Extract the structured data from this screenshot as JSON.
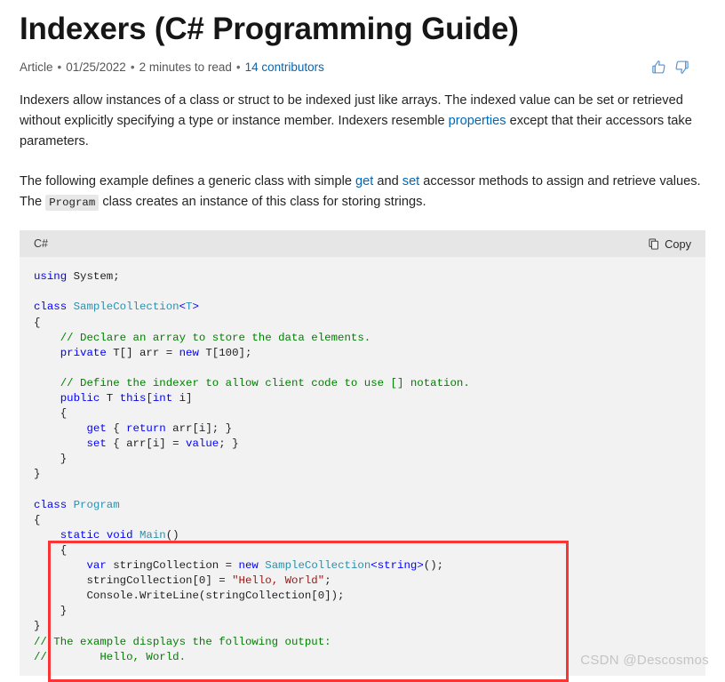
{
  "article": {
    "title": "Indexers (C# Programming Guide)",
    "meta": {
      "type": "Article",
      "date": "01/25/2022",
      "read_time": "2 minutes to read",
      "contributors": "14 contributors",
      "separator": "•"
    },
    "rating": {
      "thumbs_up": "thumbs-up-icon",
      "thumbs_down": "thumbs-down-icon",
      "accent_color": "#4a8fd8"
    }
  },
  "paragraphs": {
    "p1_part1": "Indexers allow instances of a class or struct to be indexed just like arrays. The indexed value can be set or retrieved without explicitly specifying a type or instance member. Indexers resemble ",
    "p1_link": "properties",
    "p1_part2": " except that their accessors take parameters.",
    "p2_part1": "The following example defines a generic class with simple ",
    "p2_link_get": "get",
    "p2_part2": " and ",
    "p2_link_set": "set",
    "p2_part3": " accessor methods to assign and retrieve values. The ",
    "p2_code": "Program",
    "p2_part4": " class creates an instance of this class for storing strings."
  },
  "code_block": {
    "language": "C#",
    "copy_label": "Copy",
    "copy_icon": "copy-pages-icon",
    "lines": [
      {
        "text": "using System;",
        "tokens": [
          [
            "kw",
            "using"
          ],
          [
            "pln",
            " System;"
          ]
        ]
      },
      {
        "text": "",
        "tokens": []
      },
      {
        "text": "class SampleCollection<T>",
        "tokens": [
          [
            "kw",
            "class"
          ],
          [
            "pln",
            " "
          ],
          [
            "type",
            "SampleCollection"
          ],
          [
            "kw",
            "<"
          ],
          [
            "type",
            "T"
          ],
          [
            "kw",
            ">"
          ]
        ]
      },
      {
        "text": "{",
        "tokens": [
          [
            "pln",
            "{"
          ]
        ]
      },
      {
        "text": "    // Declare an array to store the data elements.",
        "tokens": [
          [
            "cmt",
            "    // Declare an array to store the data elements."
          ]
        ]
      },
      {
        "text": "    private T[] arr = new T[100];",
        "tokens": [
          [
            "pln",
            "    "
          ],
          [
            "kw",
            "private"
          ],
          [
            "pln",
            " T[] arr = "
          ],
          [
            "kw",
            "new"
          ],
          [
            "pln",
            " T[100];"
          ]
        ]
      },
      {
        "text": "",
        "tokens": []
      },
      {
        "text": "    // Define the indexer to allow client code to use [] notation.",
        "tokens": [
          [
            "cmt",
            "    // Define the indexer to allow client code to use [] notation."
          ]
        ]
      },
      {
        "text": "    public T this[int i]",
        "tokens": [
          [
            "pln",
            "    "
          ],
          [
            "kw",
            "public"
          ],
          [
            "pln",
            " T "
          ],
          [
            "kw",
            "this"
          ],
          [
            "pln",
            "["
          ],
          [
            "kw",
            "int"
          ],
          [
            "pln",
            " i]"
          ]
        ]
      },
      {
        "text": "    {",
        "tokens": [
          [
            "pln",
            "    {"
          ]
        ]
      },
      {
        "text": "        get { return arr[i]; }",
        "tokens": [
          [
            "pln",
            "        "
          ],
          [
            "kw",
            "get"
          ],
          [
            "pln",
            " { "
          ],
          [
            "kw",
            "return"
          ],
          [
            "pln",
            " arr[i]; }"
          ]
        ]
      },
      {
        "text": "        set { arr[i] = value; }",
        "tokens": [
          [
            "pln",
            "        "
          ],
          [
            "kw",
            "set"
          ],
          [
            "pln",
            " { arr[i] = "
          ],
          [
            "kw",
            "value"
          ],
          [
            "pln",
            "; }"
          ]
        ]
      },
      {
        "text": "    }",
        "tokens": [
          [
            "pln",
            "    }"
          ]
        ]
      },
      {
        "text": "}",
        "tokens": [
          [
            "pln",
            "}"
          ]
        ]
      },
      {
        "text": "",
        "tokens": []
      },
      {
        "text": "class Program",
        "tokens": [
          [
            "kw",
            "class"
          ],
          [
            "pln",
            " "
          ],
          [
            "type",
            "Program"
          ]
        ]
      },
      {
        "text": "{",
        "tokens": [
          [
            "pln",
            "{"
          ]
        ]
      },
      {
        "text": "    static void Main()",
        "tokens": [
          [
            "pln",
            "    "
          ],
          [
            "kw",
            "static"
          ],
          [
            "pln",
            " "
          ],
          [
            "kw",
            "void"
          ],
          [
            "pln",
            " "
          ],
          [
            "type",
            "Main"
          ],
          [
            "pln",
            "()"
          ]
        ]
      },
      {
        "text": "    {",
        "tokens": [
          [
            "pln",
            "    {"
          ]
        ]
      },
      {
        "text": "        var stringCollection = new SampleCollection<string>();",
        "tokens": [
          [
            "pln",
            "        "
          ],
          [
            "kw",
            "var"
          ],
          [
            "pln",
            " stringCollection = "
          ],
          [
            "kw",
            "new"
          ],
          [
            "pln",
            " "
          ],
          [
            "type",
            "SampleCollection"
          ],
          [
            "kw",
            "<"
          ],
          [
            "kw",
            "string"
          ],
          [
            "kw",
            ">"
          ],
          [
            "pln",
            "();"
          ]
        ]
      },
      {
        "text": "        stringCollection[0] = \"Hello, World\";",
        "tokens": [
          [
            "pln",
            "        stringCollection[0] = "
          ],
          [
            "str",
            "\"Hello, World\""
          ],
          [
            "pln",
            ";"
          ]
        ]
      },
      {
        "text": "        Console.WriteLine(stringCollection[0]);",
        "tokens": [
          [
            "pln",
            "        Console.WriteLine(stringCollection[0]);"
          ]
        ]
      },
      {
        "text": "    }",
        "tokens": [
          [
            "pln",
            "    }"
          ]
        ]
      },
      {
        "text": "}",
        "tokens": [
          [
            "pln",
            "}"
          ]
        ]
      },
      {
        "text": "// The example displays the following output:",
        "tokens": [
          [
            "cmt",
            "// The example displays the following output:"
          ]
        ]
      },
      {
        "text": "//        Hello, World.",
        "tokens": [
          [
            "cmt",
            "//        Hello, World."
          ]
        ]
      }
    ]
  },
  "annotation": {
    "color": "#fa3535",
    "shape": "rectangle"
  },
  "watermark": {
    "text": "CSDN @Descosmos"
  }
}
